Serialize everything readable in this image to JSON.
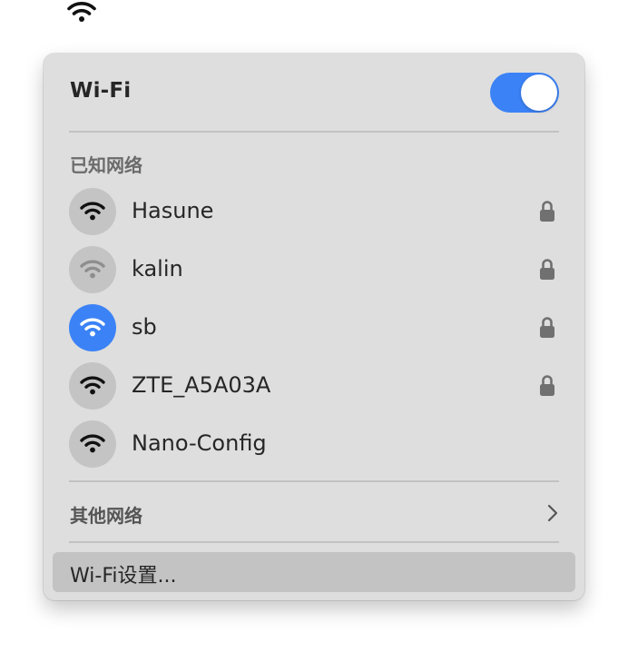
{
  "menubar": {
    "icon": "wifi-icon"
  },
  "panel": {
    "title": "Wi-Fi",
    "toggle_on": true,
    "accent_color": "#3b82f6",
    "known_networks_label": "已知网络",
    "networks": [
      {
        "name": "Hasune",
        "secured": true,
        "signal": "strong",
        "connected": false
      },
      {
        "name": "kalin",
        "secured": true,
        "signal": "weak",
        "connected": false
      },
      {
        "name": "sb",
        "secured": true,
        "signal": "strong",
        "connected": true
      },
      {
        "name": "ZTE_A5A03A",
        "secured": true,
        "signal": "strong",
        "connected": false
      },
      {
        "name": "Nano-Config",
        "secured": false,
        "signal": "strong",
        "connected": false
      }
    ],
    "other_networks_label": "其他网络",
    "settings_label": "Wi-Fi设置..."
  }
}
